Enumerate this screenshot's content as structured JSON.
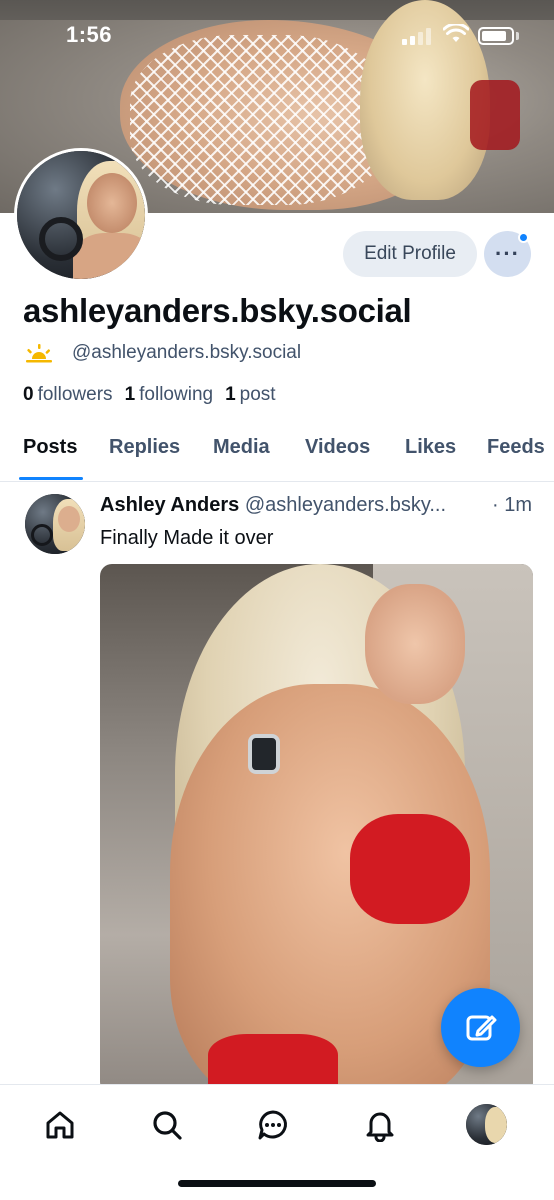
{
  "status_bar": {
    "time": "1:56"
  },
  "profile": {
    "display_name": "ashleyanders.bsky.social",
    "handle": "@ashleyanders.bsky.social",
    "followers_count": "0",
    "followers_label": "followers",
    "following_count": "1",
    "following_label": "following",
    "posts_count": "1",
    "posts_label": "post",
    "edit_profile_label": "Edit Profile",
    "more_label": "···"
  },
  "tabs": [
    {
      "label": "Posts",
      "active": true
    },
    {
      "label": "Replies",
      "active": false
    },
    {
      "label": "Media",
      "active": false
    },
    {
      "label": "Videos",
      "active": false
    },
    {
      "label": "Likes",
      "active": false
    },
    {
      "label": "Feeds",
      "active": false
    }
  ],
  "post": {
    "author": "Ashley Anders",
    "handle": "@ashleyanders.bsky...",
    "time": "· 1m",
    "text": "Finally Made it over"
  },
  "nav": {
    "items": [
      "home-icon",
      "search-icon",
      "chat-icon",
      "bell-icon",
      "profile-avatar"
    ]
  },
  "colors": {
    "accent": "#1083fe",
    "muted_text": "#42536b",
    "primary_text": "#0b0f14",
    "button_bg": "#e8edf3"
  }
}
